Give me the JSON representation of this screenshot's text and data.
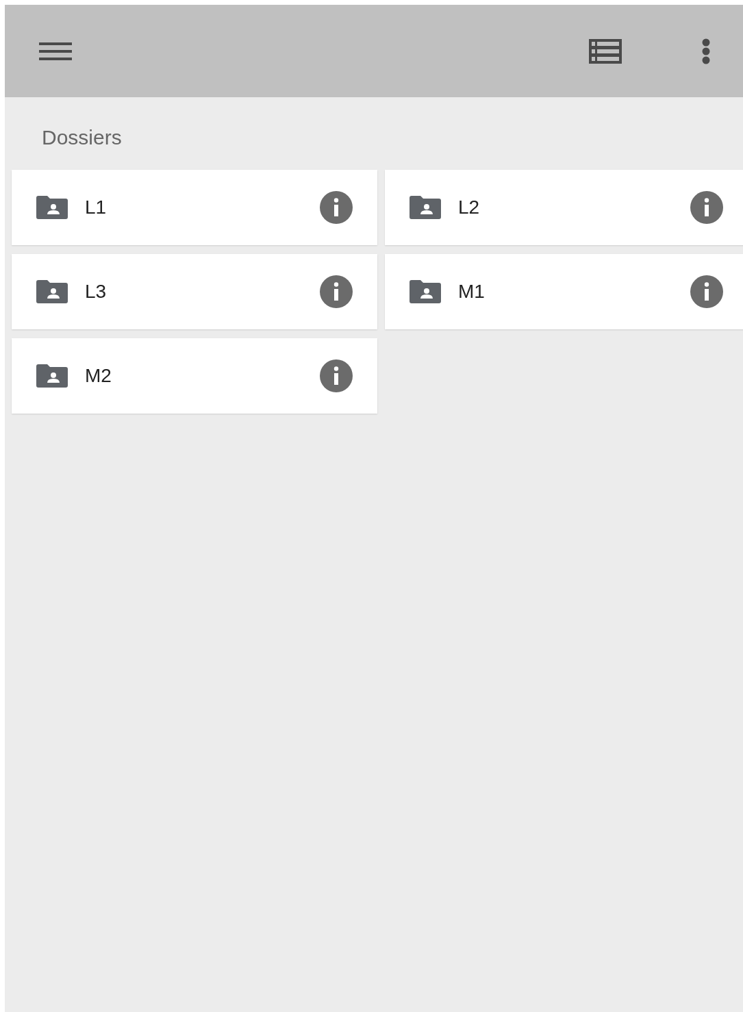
{
  "section_title": "Dossiers",
  "folders": [
    {
      "name": "L1"
    },
    {
      "name": "L2"
    },
    {
      "name": "L3"
    },
    {
      "name": "M1"
    },
    {
      "name": "M2"
    }
  ]
}
